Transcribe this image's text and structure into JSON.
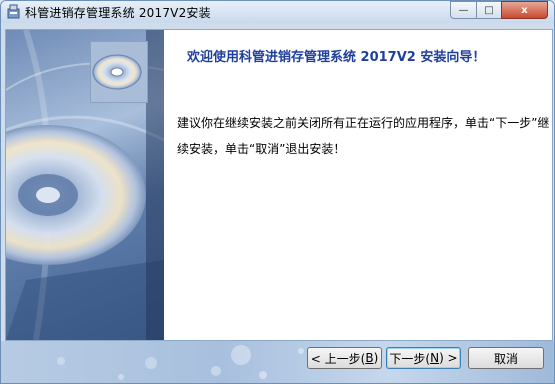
{
  "window": {
    "title": "科管进销存管理系统 2017V2安装",
    "min_label": "—",
    "max_label": "□",
    "close_label": "x"
  },
  "content": {
    "heading": "欢迎使用科管进销存管理系统 2017V2 安装向导！",
    "paragraph": "建议你在继续安装之前关闭所有正在运行的应用程序，单击“下一步”继续安装，单击“取消”退出安装！"
  },
  "buttons": {
    "back_prefix": "< 上一步(",
    "back_key": "B",
    "back_suffix": ")",
    "next_prefix": "下一步(",
    "next_key": "N",
    "next_suffix": ") >",
    "cancel": "取消"
  },
  "icons": {
    "app": "installer-app-icon",
    "cd": "cd-disc-icon"
  }
}
